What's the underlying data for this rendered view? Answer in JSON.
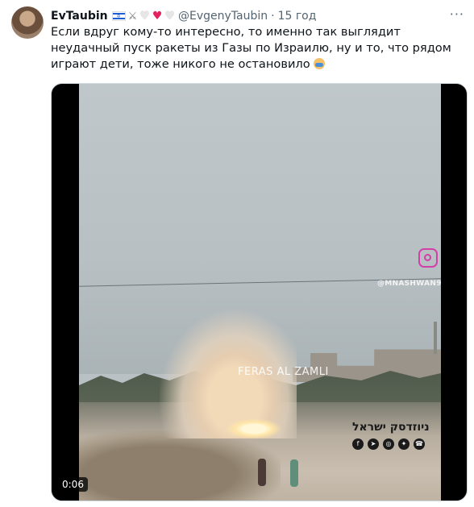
{
  "tweet": {
    "display_name": "EvTaubin",
    "handle": "@EvgenyTaubin",
    "separator": "·",
    "time": "15 год",
    "text": "Если вдруг кому-то интересно, то именно так выглядит неудачный пуск ракеты из Газы по Израилю, ну и то, что рядом играют дети, тоже никого не остановило",
    "name_emojis": [
      "israel-flag",
      "crossed-swords",
      "white-heart",
      "red-heart",
      "white-heart"
    ],
    "trailing_emoji": "man-facepalming"
  },
  "video": {
    "watermark_handle": "@MNASHWAN90",
    "overlay_name": "FERAS AL ZAMLI",
    "hebrew_logo": "ניוזדסק ישראל",
    "duration": "0:06"
  },
  "colors": {
    "text_primary": "#0f1419",
    "text_secondary": "#536471",
    "heart_red": "#e0245e",
    "instagram": "#d43ea7"
  }
}
